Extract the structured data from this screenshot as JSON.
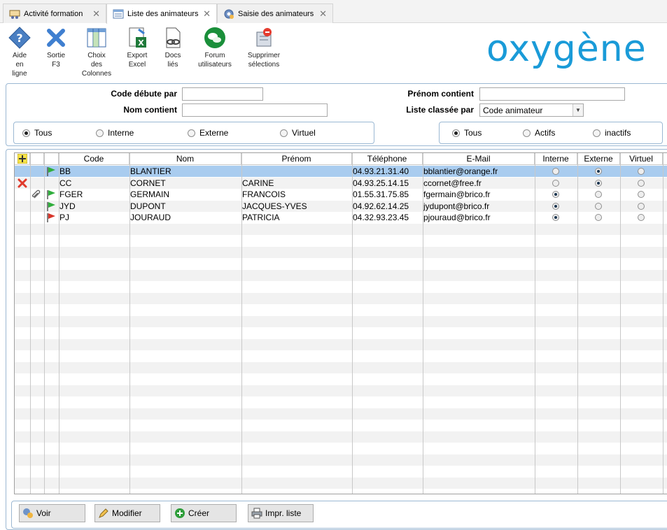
{
  "tabs": [
    {
      "label": "Activité formation",
      "active": false
    },
    {
      "label": "Liste des animateurs",
      "active": true
    },
    {
      "label": "Saisie des animateurs",
      "active": false
    }
  ],
  "toolbar": {
    "help": [
      "Aide",
      "en",
      "ligne"
    ],
    "exit": [
      "Sortie",
      "F3"
    ],
    "columns": [
      "Choix",
      "des",
      "Colonnes"
    ],
    "export": [
      "Export",
      "Excel"
    ],
    "docs": [
      "Docs",
      "liés"
    ],
    "forum": [
      "Forum",
      "utilisateurs"
    ],
    "delete_sel": [
      "Supprimer",
      "sélections"
    ]
  },
  "logo": "oxygène",
  "filters": {
    "code_label": "Code débute par",
    "code_value": "",
    "nom_label": "Nom contient",
    "nom_value": "",
    "prenom_label": "Prénom contient",
    "prenom_value": "",
    "sort_label": "Liste classée par",
    "sort_value": "Code animateur",
    "type_options": [
      "Tous",
      "Interne",
      "Externe",
      "Virtuel"
    ],
    "type_selected": "Tous",
    "status_options": [
      "Tous",
      "Actifs",
      "inactifs"
    ],
    "status_selected": "Tous"
  },
  "grid": {
    "columns": [
      "Code",
      "Nom",
      "Prénom",
      "Téléphone",
      "E-Mail",
      "Interne",
      "Externe",
      "Virtuel"
    ],
    "rows": [
      {
        "code": "BB",
        "nom": "BLANTIER",
        "prenom": "",
        "tel": "04.93.21.31.40",
        "email": "bblantier@orange.fr",
        "type": "Externe",
        "flag": "green",
        "deleted": false,
        "attach": false
      },
      {
        "code": "CC",
        "nom": "CORNET",
        "prenom": "CARINE",
        "tel": "04.93.25.14.15",
        "email": "ccornet@free.fr",
        "type": "Externe",
        "flag": "",
        "deleted": true,
        "attach": false
      },
      {
        "code": "FGER",
        "nom": "GERMAIN",
        "prenom": "FRANCOIS",
        "tel": "01.55.31.75.85",
        "email": "fgermain@brico.fr",
        "type": "Interne",
        "flag": "green",
        "deleted": false,
        "attach": true
      },
      {
        "code": "JYD",
        "nom": "DUPONT",
        "prenom": "JACQUES-YVES",
        "tel": "04.92.62.14.25",
        "email": "jydupont@brico.fr",
        "type": "Interne",
        "flag": "green",
        "deleted": false,
        "attach": false
      },
      {
        "code": "PJ",
        "nom": "JOURAUD",
        "prenom": "PATRICIA",
        "tel": "04.32.93.23.45",
        "email": "pjouraud@brico.fr",
        "type": "Interne",
        "flag": "red",
        "deleted": false,
        "attach": false
      }
    ],
    "selected_row": 0
  },
  "buttons": {
    "view": "Voir",
    "edit": "Modifier",
    "create": "Créer",
    "print": "Impr. liste"
  }
}
